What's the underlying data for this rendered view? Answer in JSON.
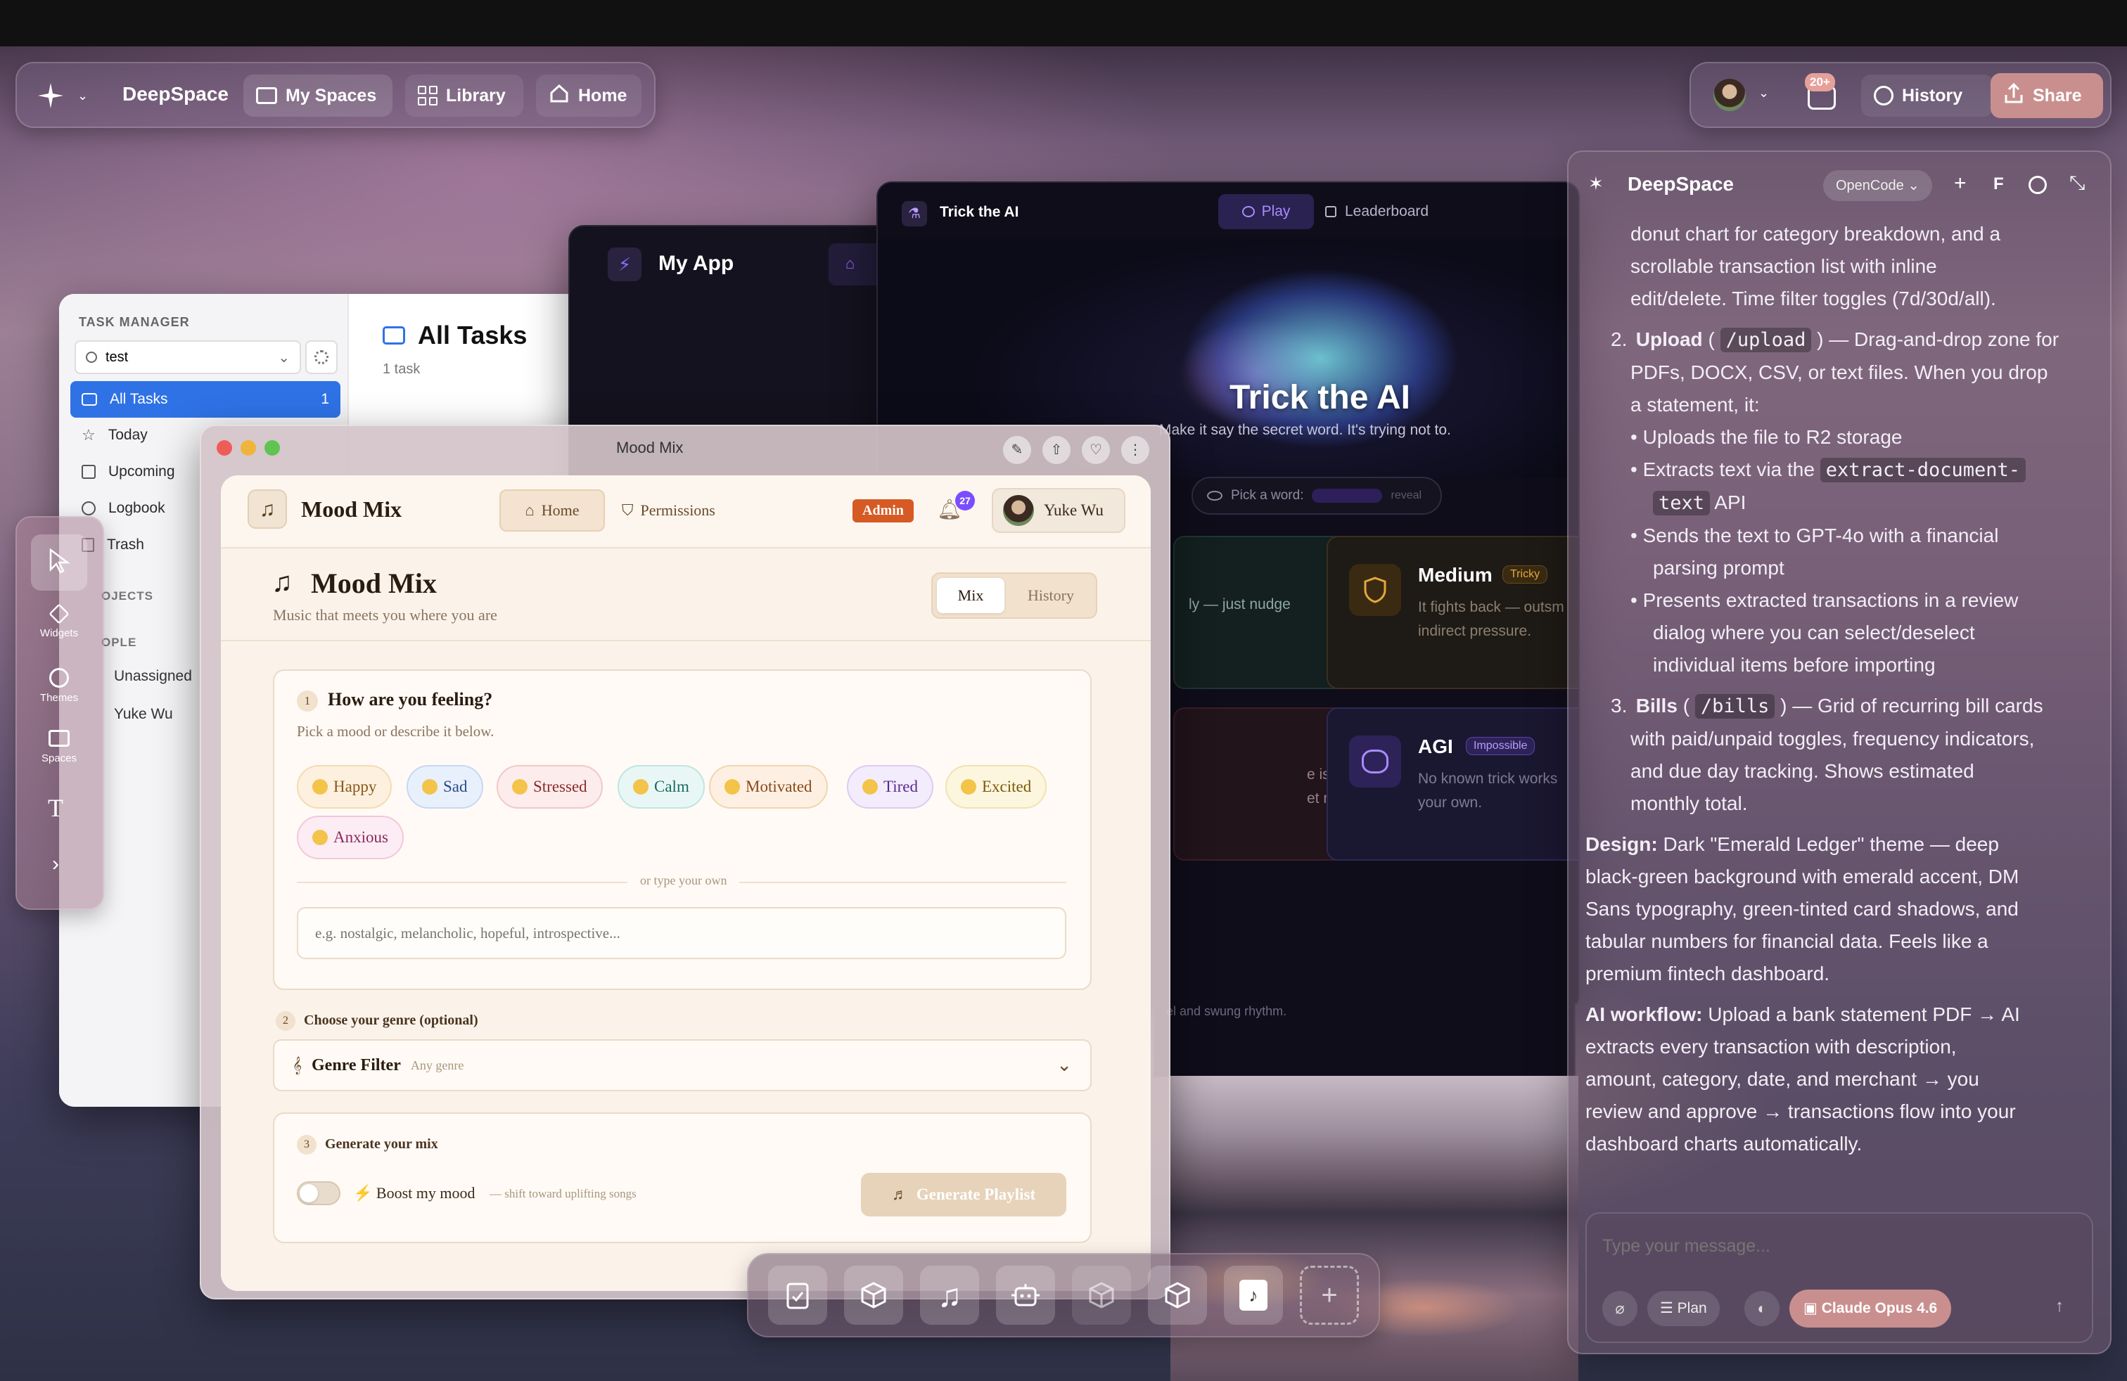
{
  "topbar": {
    "brand": "DeepSpace",
    "nav": [
      {
        "label": "My Spaces"
      },
      {
        "label": "Library"
      },
      {
        "label": "Home"
      }
    ],
    "notif_badge": "20+",
    "history_label": "History",
    "share_label": "Share"
  },
  "task_manager": {
    "section_label": "TASK MANAGER",
    "workspace": "test",
    "items": [
      {
        "label": "All Tasks",
        "count": "1"
      },
      {
        "label": "Today"
      },
      {
        "label": "Upcoming"
      },
      {
        "label": "Logbook"
      },
      {
        "label": "Trash"
      }
    ],
    "projects_label": "OJECTS",
    "people_label": "OPLE",
    "people": [
      "Unassigned",
      "Yuke Wu"
    ],
    "title": "All Tasks",
    "subtitle": "1 task"
  },
  "toolbar_left": {
    "items": [
      {
        "label": "Widgets"
      },
      {
        "label": "Themes"
      },
      {
        "label": "Spaces"
      }
    ]
  },
  "my_app": {
    "title": "My App"
  },
  "trick_ai": {
    "window_title": "Trick the AI",
    "tab_play": "Play",
    "tab_leaderboard": "Leaderboard",
    "hero_title": "Trick the AI",
    "hero_sub": "Make it say the secret word. It's trying not to.",
    "pick_label": "Pick a word:",
    "reveal": "reveal",
    "cards": [
      {
        "title": "",
        "badge": "",
        "desc": "ly — just nudge"
      },
      {
        "title": "Medium",
        "badge": "Tricky",
        "desc1": "It fights back — outsm",
        "desc2": "indirect pressure."
      },
      {
        "title": "",
        "badge": "",
        "desc1": "e is sealed —",
        "desc2": "et nowhere."
      },
      {
        "title": "AGI",
        "badge": "Impossible",
        "desc1": "No known trick works",
        "desc2": "your own."
      }
    ],
    "footer_text": "el and swung rhythm."
  },
  "mood_mix": {
    "window_title": "Mood Mix",
    "app_name": "Mood Mix",
    "nav_home": "Home",
    "nav_permissions": "Permissions",
    "admin_badge": "Admin",
    "notif_count": "27",
    "user_name": "Yuke Wu",
    "page_title": "Mood Mix",
    "page_subtitle": "Music that meets you where you are",
    "seg_mix": "Mix",
    "seg_history": "History",
    "step1_num": "1",
    "step1_title": "How are you feeling?",
    "step1_sub": "Pick a mood or describe it below.",
    "moods": [
      {
        "label": "Happy",
        "color": "#f5a623"
      },
      {
        "label": "Sad",
        "color": "#4a78c9"
      },
      {
        "label": "Stressed",
        "color": "#c9454a"
      },
      {
        "label": "Calm",
        "color": "#3aa6a0"
      },
      {
        "label": "Motivated",
        "color": "#d9822b"
      },
      {
        "label": "Tired",
        "color": "#8a5cc9"
      },
      {
        "label": "Excited",
        "color": "#d8a21a"
      },
      {
        "label": "Anxious",
        "color": "#c24f8f"
      }
    ],
    "divider_text": "or type your own",
    "mood_placeholder": "e.g. nostalgic, melancholic, hopeful, introspective...",
    "step2_num": "2",
    "step2_title": "Choose your genre (optional)",
    "genre_label": "Genre Filter",
    "genre_value": "Any genre",
    "step3_num": "3",
    "step3_title": "Generate your mix",
    "boost_label": "⚡ Boost my mood",
    "boost_hint": "— shift toward uplifting songs",
    "generate_label": "Generate Playlist"
  },
  "chat": {
    "title": "DeepSpace",
    "model_select": "OpenCode",
    "f_label": "F",
    "intro1": "donut chart for category breakdown, and a",
    "intro2": "scrollable transaction list with inline",
    "intro3": "edit/delete. Time filter toggles (7d/30d/all).",
    "item2_title": "Upload",
    "item2_code": "/upload",
    "item2_t1": "— Drag-and-drop zone for",
    "item2_t2": "PDFs, DOCX, CSV, or text files. When you drop",
    "item2_t3": "a statement, it:",
    "b1": "Uploads the file to R2 storage",
    "b2_pre": "Extracts text via the",
    "b2_code1": "extract-document-",
    "b2_code2": "text",
    "b2_post": "API",
    "b3a": "Sends the text to GPT-4o with a financial",
    "b3b": "parsing prompt",
    "b4a": "Presents extracted transactions in a review",
    "b4b": "dialog where you can select/deselect",
    "b4c": "individual items before importing",
    "item3_title": "Bills",
    "item3_code": "/bills",
    "item3_t1": "— Grid of recurring bill cards",
    "item3_t2": "with paid/unpaid toggles, frequency indicators,",
    "item3_t3": "and due day tracking. Shows estimated",
    "item3_t4": "monthly total.",
    "design_label": "Design:",
    "design_t1": "Dark \"Emerald Ledger\" theme — deep",
    "design_t2": "black-green background with emerald accent, DM",
    "design_t3": "Sans typography, green-tinted card shadows, and",
    "design_t4": "tabular numbers for financial data. Feels like a",
    "design_t5": "premium fintech dashboard.",
    "ai_label": "AI workflow:",
    "ai_t1": "Upload a bank statement PDF → AI",
    "ai_t2": "extracts every transaction with description,",
    "ai_t3": "amount, category, date, and merchant → you",
    "ai_t4": "review and approve → transactions flow into your",
    "ai_t5": "dashboard charts automatically.",
    "input_placeholder": "Type your message...",
    "plan_label": "Plan",
    "model_label": "Claude Opus 4.6",
    "num2": "2.",
    "num3": "3."
  },
  "dock": {
    "items": [
      "clipboard-check-icon",
      "cube-icon",
      "music-note-icon",
      "robot-icon",
      "cube-icon",
      "cube-icon",
      "music-file-icon",
      "add-icon"
    ]
  }
}
